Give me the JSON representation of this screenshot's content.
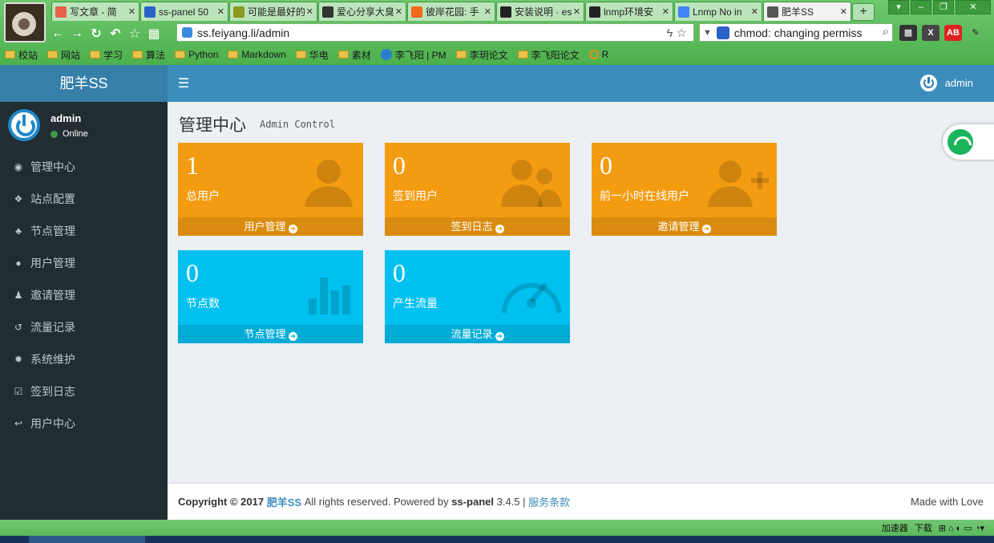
{
  "browser": {
    "tabs": [
      {
        "title": "写文章 - 简",
        "fav_color": "#e8624a"
      },
      {
        "title": "ss-panel 50",
        "fav_color": "#2a62c9"
      },
      {
        "title": "可能是最好的",
        "fav_color": "#8a9a20"
      },
      {
        "title": "爱心分享大臭",
        "fav_color": "#333333"
      },
      {
        "title": "彼岸花园: 手",
        "fav_color": "#f06a1a"
      },
      {
        "title": "安装说明 · es",
        "fav_color": "#222222"
      },
      {
        "title": "lnmp环境安",
        "fav_color": "#222222"
      },
      {
        "title": "Lnmp No in",
        "fav_color": "#4285f4"
      },
      {
        "title": "肥羊SS",
        "fav_color": "#555555"
      }
    ],
    "url": "ss.feiyang.li/admin",
    "search_text": "chmod: changing permiss",
    "bookmarks": [
      {
        "label": "校站",
        "kind": "folder"
      },
      {
        "label": "网站",
        "kind": "folder"
      },
      {
        "label": "学习",
        "kind": "folder"
      },
      {
        "label": "算法",
        "kind": "folder"
      },
      {
        "label": "Python",
        "kind": "folder"
      },
      {
        "label": "Markdown",
        "kind": "folder"
      },
      {
        "label": "华电",
        "kind": "folder"
      },
      {
        "label": "素材",
        "kind": "folder"
      },
      {
        "label": "李飞阳 | PM",
        "kind": "site"
      },
      {
        "label": "李玥论文",
        "kind": "folder"
      },
      {
        "label": "李飞阳论文",
        "kind": "folder"
      },
      {
        "label": "R",
        "kind": "ring"
      }
    ],
    "status_items": [
      "加速器",
      "下载"
    ]
  },
  "app": {
    "logo": "肥羊SS",
    "topbar_user": "admin",
    "sidebar_user": {
      "name": "admin",
      "status": "Online"
    },
    "menu": [
      {
        "label": "管理中心",
        "icon": "dashboard-icon",
        "glyph": "◉"
      },
      {
        "label": "站点配置",
        "icon": "cubes-icon",
        "glyph": "❖"
      },
      {
        "label": "节点管理",
        "icon": "sitemap-icon",
        "glyph": "♣"
      },
      {
        "label": "用户管理",
        "icon": "user-icon",
        "glyph": "●"
      },
      {
        "label": "邀请管理",
        "icon": "users-icon",
        "glyph": "♟"
      },
      {
        "label": "流量记录",
        "icon": "history-icon",
        "glyph": "↺"
      },
      {
        "label": "系统维护",
        "icon": "cog-icon",
        "glyph": "✹"
      },
      {
        "label": "签到日志",
        "icon": "check-square-icon",
        "glyph": "☑"
      },
      {
        "label": "用户中心",
        "icon": "reply-icon",
        "glyph": "↩"
      }
    ],
    "page_title": "管理中心",
    "page_subtitle": "Admin Control",
    "boxes": [
      {
        "value": "1",
        "label": "总用户",
        "link": "用户管理",
        "icon": "user-icon",
        "color": "orange"
      },
      {
        "value": "0",
        "label": "签到用户",
        "link": "签到日志",
        "icon": "users-icon",
        "color": "orange"
      },
      {
        "value": "0",
        "label": "前一小时在线用户",
        "link": "邀请管理",
        "icon": "user-plus-icon",
        "color": "orange"
      },
      {
        "value": "0",
        "label": "节点数",
        "link": "节点管理",
        "icon": "bar-chart-icon",
        "color": "aqua"
      },
      {
        "value": "0",
        "label": "产生流量",
        "link": "流量记录",
        "icon": "dashboard-gauge-icon",
        "color": "aqua"
      }
    ],
    "footer": {
      "copyright": "Copyright © 2017",
      "brand": "肥羊SS",
      "rights": "All rights reserved. Powered by",
      "powered": "ss-panel",
      "version": "3.4.5 |",
      "terms": "服务条款",
      "made": "Made with Love"
    }
  },
  "colors": {
    "orange": "#f39c12",
    "aqua": "#00c0ef",
    "header": "#3c8dbc",
    "sidebar": "#222d32"
  }
}
